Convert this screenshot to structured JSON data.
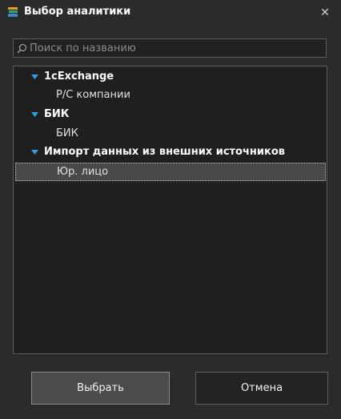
{
  "window": {
    "title": "Выбор аналитики",
    "app_icon": "stacked-books-icon",
    "close_icon": "close-icon",
    "close_symbol": "✕"
  },
  "search": {
    "placeholder": "Поиск по названию",
    "value": "",
    "icon": "search-icon"
  },
  "tree": {
    "groups": [
      {
        "label": "1cExchange",
        "expanded": true,
        "children": [
          "Р/С компании"
        ]
      },
      {
        "label": "БИК",
        "expanded": true,
        "children": [
          "БИК"
        ]
      },
      {
        "label": "Импорт данных из внешних источников",
        "expanded": true,
        "children": [
          "Юр. лицо"
        ]
      }
    ],
    "selected": "Юр. лицо"
  },
  "buttons": {
    "select_label": "Выбрать",
    "cancel_label": "Отмена"
  },
  "colors": {
    "background": "#2b2b2b",
    "tree_background": "#1f1f1f",
    "border": "#5b5b5b",
    "chevron_accent": "#2f9fe6",
    "selected_row": "#4a4a4a"
  }
}
